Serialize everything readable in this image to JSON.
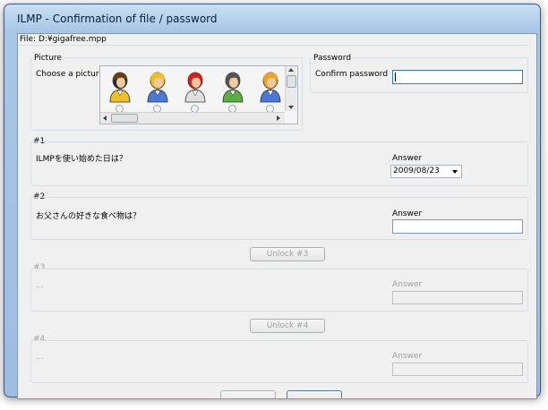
{
  "window": {
    "title": "ILMP - Confirmation of file / password"
  },
  "file": {
    "label": "File: D:¥gigafree.mpp"
  },
  "picture": {
    "group_label": "Picture",
    "prompt": "Choose a picture",
    "avatars": [
      {
        "name": "yellow-avatar",
        "shirt": "#f0c020",
        "hair": "#6a3e10",
        "head": "#2a2a2a"
      },
      {
        "name": "blue-avatar",
        "shirt": "#4a78d8",
        "hair": "#f0c020",
        "head": "#f0c020"
      },
      {
        "name": "white-avatar",
        "shirt": "#e0e0e0",
        "hair": "#d02020",
        "head": "#d02020"
      },
      {
        "name": "green-avatar",
        "shirt": "#58b040",
        "hair": "#555555",
        "head": "#555555"
      },
      {
        "name": "partial-avatar",
        "shirt": "#4a78d8",
        "hair": "#f0a020",
        "head": "#f0a020"
      }
    ]
  },
  "password": {
    "group_label": "Password",
    "confirm_label": "Confirm password",
    "value": ""
  },
  "q1": {
    "header": "#1",
    "question": "ILMPを使い始めた日は？",
    "answer_label": "Answer",
    "answer_value": "2009/08/23"
  },
  "q2": {
    "header": "#2",
    "question": "お父さんの好きな食べ物は？",
    "answer_label": "Answer",
    "answer_value": ""
  },
  "unlock3": {
    "label": "Unlock #3"
  },
  "q3": {
    "header": "#3",
    "question": "...",
    "answer_label": "Answer"
  },
  "unlock4": {
    "label": "Unlock #4"
  },
  "q4": {
    "header": "#4",
    "question": "...",
    "answer_label": "Answer"
  }
}
